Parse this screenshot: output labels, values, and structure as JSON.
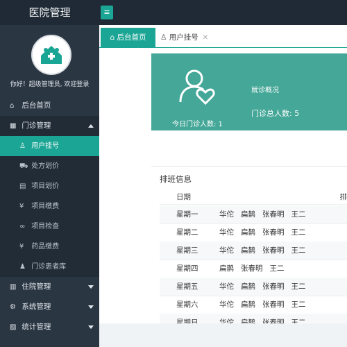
{
  "app": {
    "title": "医院管理"
  },
  "sidebar": {
    "greeting": "你好！超级管理员, 欢迎登录",
    "items": [
      {
        "label": "后台首页",
        "icon": "home-icon"
      },
      {
        "label": "门诊管理",
        "icon": "clinic-icon",
        "expanded": true,
        "children": [
          {
            "label": "用户挂号",
            "icon": "user-icon",
            "active": true
          },
          {
            "label": "处方划价",
            "icon": "cart-icon"
          },
          {
            "label": "项目划价",
            "icon": "document-icon"
          },
          {
            "label": "项目缴费",
            "icon": "yen-icon"
          },
          {
            "label": "项目检查",
            "icon": "link-icon"
          },
          {
            "label": "药品缴费",
            "icon": "yen-icon"
          },
          {
            "label": "门诊患者库",
            "icon": "person-icon"
          }
        ]
      },
      {
        "label": "住院管理",
        "icon": "hospital-icon"
      },
      {
        "label": "系统管理",
        "icon": "gear-icon"
      },
      {
        "label": "统计管理",
        "icon": "chart-icon"
      }
    ]
  },
  "tabs": [
    {
      "label": "后台首页",
      "active": true
    },
    {
      "label": "用户挂号",
      "active": false
    }
  ],
  "dashboard": {
    "today_label": "今日门诊人数: 1",
    "overview_title": "就诊概况",
    "total_label": "门诊总人数: 5"
  },
  "schedule": {
    "title": "排班信息",
    "header_date": "日期",
    "header_more": "排",
    "rows": [
      {
        "day": "星期一",
        "doctors": [
          "华佗",
          "扁鹊",
          "张春明",
          "王二"
        ]
      },
      {
        "day": "星期二",
        "doctors": [
          "华佗",
          "扁鹊",
          "张春明",
          "王二"
        ]
      },
      {
        "day": "星期三",
        "doctors": [
          "华佗",
          "扁鹊",
          "张春明",
          "王二"
        ]
      },
      {
        "day": "星期四",
        "doctors": [
          "扁鹊",
          "张春明",
          "王二"
        ]
      },
      {
        "day": "星期五",
        "doctors": [
          "华佗",
          "扁鹊",
          "张春明",
          "王二"
        ]
      },
      {
        "day": "星期六",
        "doctors": [
          "华佗",
          "扁鹊",
          "张春明",
          "王二"
        ]
      },
      {
        "day": "星期日",
        "doctors": [
          "华佗",
          "扁鹊",
          "张春明",
          "王二"
        ]
      }
    ]
  },
  "colors": {
    "accent": "#1ba594",
    "sidebar": "#2b3643",
    "topbar": "#1f2a36",
    "panel": "#45a798"
  }
}
